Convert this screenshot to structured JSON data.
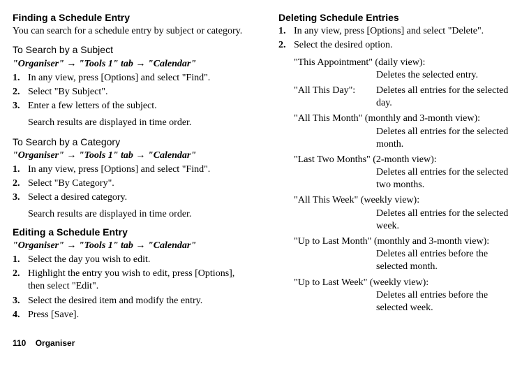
{
  "left": {
    "heading1": "Finding a Schedule Entry",
    "intro1": "You can search for a schedule entry by subject or category.",
    "sub1": "To Search by a Subject",
    "path1": "\"Organiser\" → \"Tools 1\" tab → \"Calendar\"",
    "steps1": [
      "In any view, press [Options] and select \"Find\".",
      "Select \"By Subject\".",
      "Enter a few letters of the subject."
    ],
    "after3_1": "Search results are displayed in time order.",
    "sub2": "To Search by a Category",
    "path2": "\"Organiser\" → \"Tools 1\" tab → \"Calendar\"",
    "steps2": [
      "In any view, press [Options] and select \"Find\".",
      "Select \"By Category\".",
      "Select a desired category."
    ],
    "after3_2": "Search results are displayed in time order.",
    "heading2": "Editing a Schedule Entry",
    "path3": "\"Organiser\" → \"Tools 1\" tab → \"Calendar\"",
    "steps3": [
      "Select the day you wish to edit.",
      "Highlight the entry you wish to edit, press [Options], then select \"Edit\".",
      "Select the desired item and modify the entry.",
      "Press [Save]."
    ]
  },
  "right": {
    "heading": "Deleting Schedule Entries",
    "steps": [
      "In any view, press [Options] and select \"Delete\".",
      "Select the desired option."
    ],
    "options": [
      {
        "label": "\"This Appointment\" (daily view):",
        "desc": "Deletes the selected entry.",
        "stacked": true
      },
      {
        "label": "\"All This Day\":",
        "desc": "Deletes all entries for the selected day.",
        "stacked": false
      },
      {
        "label": "\"All This Month\" (monthly and 3-month view):",
        "desc": "Deletes all entries for the selected month.",
        "stacked": true
      },
      {
        "label": "\"Last Two Months\" (2-month view):",
        "desc": "Deletes all entries for the selected two months.",
        "stacked": true
      },
      {
        "label": "\"All This Week\" (weekly view):",
        "desc": "Deletes all entries for the selected week.",
        "stacked": true
      },
      {
        "label": "\"Up to Last Month\" (monthly and 3-month view):",
        "desc": "Deletes all entries before the selected month.",
        "stacked": true
      },
      {
        "label": "\"Up to Last Week\" (weekly view):",
        "desc": "Deletes all entries before the selected week.",
        "stacked": true
      }
    ]
  },
  "footer": {
    "page": "110",
    "section": "Organiser"
  }
}
